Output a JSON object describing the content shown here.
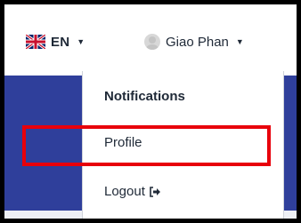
{
  "header": {
    "language": {
      "code": "EN",
      "flag_icon": "uk-flag-icon",
      "caret_icon": "caret-down-icon"
    },
    "user": {
      "name": "Giao Phan",
      "avatar_icon": "user-avatar-icon",
      "caret_icon": "caret-down-icon"
    }
  },
  "dropdown": {
    "items": [
      {
        "label": "Notifications"
      },
      {
        "label": "Profile",
        "highlighted": true
      },
      {
        "label": "Logout",
        "icon": "logout-icon"
      }
    ]
  },
  "colors": {
    "accent_bar": "#2f3f9b",
    "highlight": "#e8000b",
    "text": "#1f2937"
  }
}
